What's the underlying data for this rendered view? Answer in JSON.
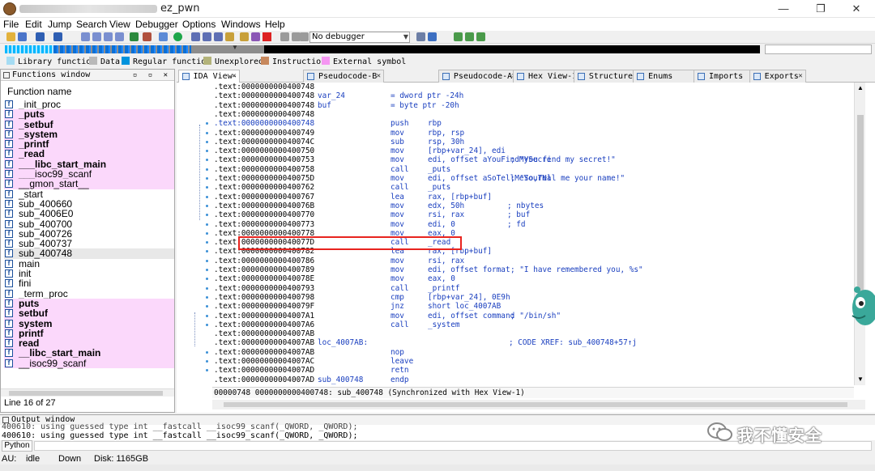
{
  "window": {
    "title": "ez_pwn",
    "min": "—",
    "restore": "❐",
    "close": "✕"
  },
  "menu": [
    "File",
    "Edit",
    "Jump",
    "Search",
    "View",
    "Debugger",
    "Options",
    "Windows",
    "Help"
  ],
  "toolbar": {
    "debugger_value": "No debugger"
  },
  "legend": [
    {
      "label": "Library function",
      "color": "#a5dcf3"
    },
    {
      "label": "Data",
      "color": "#b9b9b9"
    },
    {
      "label": "Regular function",
      "color": "#0093dd"
    },
    {
      "label": "Unexplored",
      "color": "#b3b37a"
    },
    {
      "label": "Instruction",
      "color": "#c7885d"
    },
    {
      "label": "External symbol",
      "color": "#f596f2"
    }
  ],
  "functions": {
    "header": "Functions window",
    "column": "Function name",
    "status": "Line 16 of 27",
    "items": [
      {
        "name": "_init_proc",
        "lib": false,
        "bold": false
      },
      {
        "name": "_puts",
        "lib": true,
        "bold": true
      },
      {
        "name": "_setbuf",
        "lib": true,
        "bold": true
      },
      {
        "name": "_system",
        "lib": true,
        "bold": true
      },
      {
        "name": "_printf",
        "lib": true,
        "bold": true
      },
      {
        "name": "_read",
        "lib": true,
        "bold": true
      },
      {
        "name": "___libc_start_main",
        "lib": true,
        "bold": true
      },
      {
        "name": "___isoc99_scanf",
        "lib": true,
        "bold": false
      },
      {
        "name": "__gmon_start__",
        "lib": true,
        "bold": false
      },
      {
        "name": "_start",
        "lib": false,
        "bold": false
      },
      {
        "name": "sub_400660",
        "lib": false,
        "bold": false
      },
      {
        "name": "sub_4006E0",
        "lib": false,
        "bold": false
      },
      {
        "name": "sub_400700",
        "lib": false,
        "bold": false
      },
      {
        "name": "sub_400726",
        "lib": false,
        "bold": false
      },
      {
        "name": "sub_400737",
        "lib": false,
        "bold": false
      },
      {
        "name": "sub_400748",
        "lib": false,
        "bold": false,
        "selected": true
      },
      {
        "name": "main",
        "lib": false,
        "bold": false
      },
      {
        "name": "init",
        "lib": false,
        "bold": false
      },
      {
        "name": "fini",
        "lib": false,
        "bold": false
      },
      {
        "name": "_term_proc",
        "lib": false,
        "bold": false
      },
      {
        "name": "puts",
        "lib": true,
        "bold": true
      },
      {
        "name": "setbuf",
        "lib": true,
        "bold": true
      },
      {
        "name": "system",
        "lib": true,
        "bold": true
      },
      {
        "name": "printf",
        "lib": true,
        "bold": true
      },
      {
        "name": "read",
        "lib": true,
        "bold": true
      },
      {
        "name": "__libc_start_main",
        "lib": true,
        "bold": true
      },
      {
        "name": "__isoc99_scanf",
        "lib": true,
        "bold": false
      }
    ]
  },
  "tabs": [
    {
      "label": "IDA View-A",
      "active": true
    },
    {
      "label": "Pseudocode-B",
      "active": false
    },
    {
      "label": "Pseudocode-A",
      "active": false
    },
    {
      "label": "Hex View-1",
      "active": false
    },
    {
      "label": "Structures",
      "active": false
    },
    {
      "label": "Enums",
      "active": false
    },
    {
      "label": "Imports",
      "active": false
    },
    {
      "label": "Exports",
      "active": false
    }
  ],
  "code": [
    {
      "addr": ".text:0000000000400748",
      "label": "",
      "mn": "",
      "op": "",
      "cmt": ""
    },
    {
      "addr": ".text:0000000000400748",
      "label": "var_24",
      "mn": "= dword ptr -24h",
      "op": "",
      "cmt": ""
    },
    {
      "addr": ".text:0000000000400748",
      "label": "buf",
      "mn": "= byte ptr -20h",
      "op": "",
      "cmt": ""
    },
    {
      "addr": ".text:0000000000400748",
      "label": "",
      "mn": "",
      "op": "",
      "cmt": ""
    },
    {
      "addr": ".text:0000000000400748",
      "label": "",
      "mn": "push",
      "op": "rbp",
      "cmt": "",
      "hl": true
    },
    {
      "addr": ".text:0000000000400749",
      "label": "",
      "mn": "mov",
      "op": "rbp, rsp",
      "cmt": ""
    },
    {
      "addr": ".text:000000000040074C",
      "label": "",
      "mn": "sub",
      "op": "rsp, 30h",
      "cmt": ""
    },
    {
      "addr": ".text:0000000000400750",
      "label": "",
      "mn": "mov",
      "op": "[rbp+var_24], edi",
      "cmt": ""
    },
    {
      "addr": ".text:0000000000400753",
      "label": "",
      "mn": "mov",
      "op": "edi, offset aYouFindMySecre",
      "cmt": "; \"You find my secret!\""
    },
    {
      "addr": ".text:0000000000400758",
      "label": "",
      "mn": "call",
      "op": "_puts",
      "cmt": ""
    },
    {
      "addr": ".text:000000000040075D",
      "label": "",
      "mn": "mov",
      "op": "edi, offset aSoTellMeYourNa",
      "cmt": "; \"So,Tell me your name!\""
    },
    {
      "addr": ".text:0000000000400762",
      "label": "",
      "mn": "call",
      "op": "_puts",
      "cmt": ""
    },
    {
      "addr": ".text:0000000000400767",
      "label": "",
      "mn": "lea",
      "op": "rax, [rbp+buf]",
      "cmt": ""
    },
    {
      "addr": ".text:000000000040076B",
      "label": "",
      "mn": "mov",
      "op": "edx, 50h",
      "cmt": "; nbytes"
    },
    {
      "addr": ".text:0000000000400770",
      "label": "",
      "mn": "mov",
      "op": "rsi, rax",
      "cmt": "; buf"
    },
    {
      "addr": ".text:0000000000400773",
      "label": "",
      "mn": "mov",
      "op": "edi, 0",
      "cmt": "; fd"
    },
    {
      "addr": ".text:0000000000400778",
      "label": "",
      "mn": "mov",
      "op": "eax, 0",
      "cmt": ""
    },
    {
      "addr": ".text:000000000040077D",
      "label": "",
      "mn": "call",
      "op": "_read",
      "cmt": ""
    },
    {
      "addr": ".text:0000000000400782",
      "label": "",
      "mn": "lea",
      "op": "rax, [rbp+buf]",
      "cmt": ""
    },
    {
      "addr": ".text:0000000000400786",
      "label": "",
      "mn": "mov",
      "op": "rsi, rax",
      "cmt": ""
    },
    {
      "addr": ".text:0000000000400789",
      "label": "",
      "mn": "mov",
      "op": "edi, offset format",
      "cmt": "; \"I have remembered you, %s\""
    },
    {
      "addr": ".text:000000000040078E",
      "label": "",
      "mn": "mov",
      "op": "eax, 0",
      "cmt": ""
    },
    {
      "addr": ".text:0000000000400793",
      "label": "",
      "mn": "call",
      "op": "_printf",
      "cmt": ""
    },
    {
      "addr": ".text:0000000000400798",
      "label": "",
      "mn": "cmp",
      "op": "[rbp+var_24], 0E9h",
      "cmt": ""
    },
    {
      "addr": ".text:000000000040079F",
      "label": "",
      "mn": "jnz",
      "op": "short loc_4007AB",
      "cmt": ""
    },
    {
      "addr": ".text:00000000004007A1",
      "label": "",
      "mn": "mov",
      "op": "edi, offset command",
      "cmt": "; \"/bin/sh\""
    },
    {
      "addr": ".text:00000000004007A6",
      "label": "",
      "mn": "call",
      "op": "_system",
      "cmt": ""
    },
    {
      "addr": ".text:00000000004007AB",
      "label": "",
      "mn": "",
      "op": "",
      "cmt": ""
    },
    {
      "addr": ".text:00000000004007AB",
      "label": "loc_4007AB:",
      "mn": "",
      "op": "",
      "cmt": "",
      "xref": "; CODE XREF: sub_400748+57↑j"
    },
    {
      "addr": ".text:00000000004007AB",
      "label": "",
      "mn": "nop",
      "op": "",
      "cmt": ""
    },
    {
      "addr": ".text:00000000004007AC",
      "label": "",
      "mn": "leave",
      "op": "",
      "cmt": ""
    },
    {
      "addr": ".text:00000000004007AD",
      "label": "",
      "mn": "retn",
      "op": "",
      "cmt": ""
    },
    {
      "addr": ".text:00000000004007AD",
      "label": "sub_400748",
      "mn": "endp",
      "op": "",
      "cmt": ""
    }
  ],
  "sync_status": "00000748 0000000000400748: sub_400748 (Synchronized with Hex View-1)",
  "output": {
    "header": "Output window",
    "lines": [
      "400610: using guessed type int __fastcall __isoc99_scanf(_QWORD, _QWORD);",
      "400610: using guessed type int __fastcall __isoc99_scanf(_QWORD, _QWORD);"
    ],
    "python_label": "Python"
  },
  "status": {
    "au": "AU:",
    "state": "idle",
    "dir": "Down",
    "disk": "Disk: 1165GB"
  },
  "watermark": "我不懂安全"
}
